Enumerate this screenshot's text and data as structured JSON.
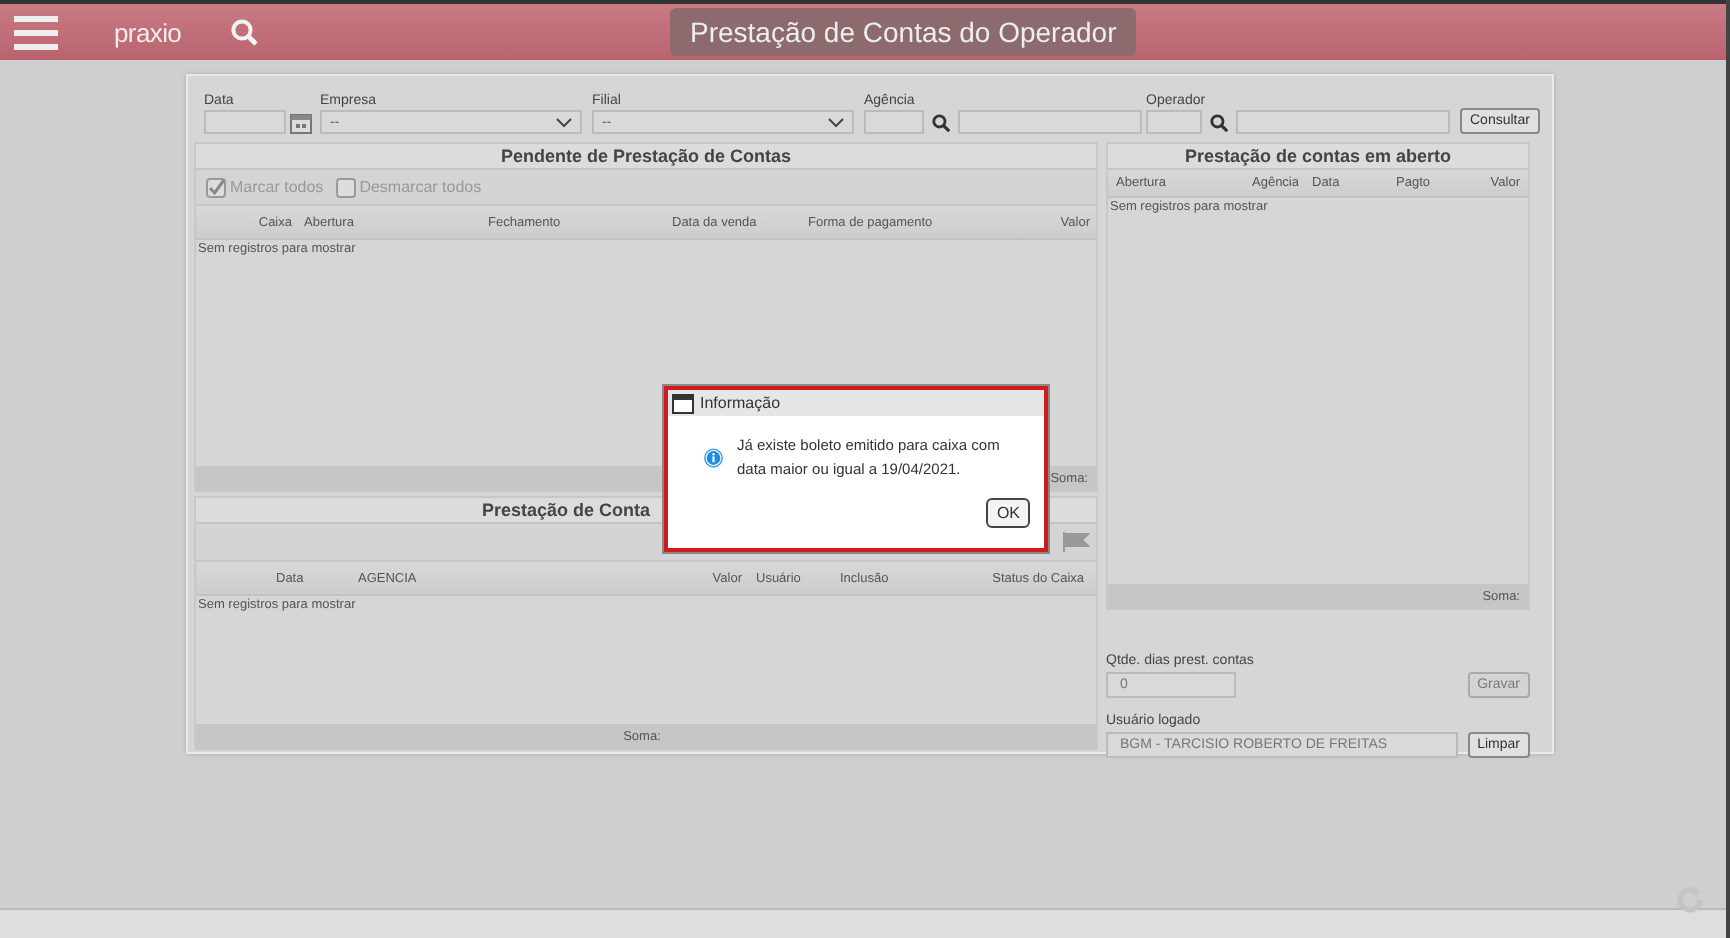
{
  "app": {
    "logo": "praxio",
    "title": "Prestação de Contas do Operador"
  },
  "filters": [
    {
      "label": "Data",
      "kind": "date"
    },
    {
      "label": "Empresa",
      "kind": "select",
      "value": "--"
    },
    {
      "label": "Filial",
      "kind": "select",
      "value": "--"
    },
    {
      "label": "Agência",
      "kind": "lookup"
    },
    {
      "label": "Operador",
      "kind": "lookup"
    }
  ],
  "consult_button": "Consultar",
  "pending": {
    "title": "Pendente de Prestação de Contas",
    "toolbar": [
      {
        "label": "Marcar todos",
        "checked": true
      },
      {
        "label": "Desmarcar todos",
        "checked": false
      }
    ],
    "columns": [
      "Caixa",
      "Abertura",
      "Fechamento",
      "Data da venda",
      "Forma de pagamento",
      "Valor"
    ],
    "empty": "Sem registros para mostrar",
    "footer": "Soma:"
  },
  "accounts": {
    "title": "Prestação de Conta",
    "columns": [
      "Data",
      "AGENCIA",
      "Valor",
      "Usuário",
      "Inclusão",
      "Status do Caixa"
    ],
    "empty": "Sem registros para mostrar",
    "footer": "Soma:"
  },
  "open": {
    "title": "Prestação de contas em aberto",
    "columns": [
      "Abertura",
      "Agência",
      "Data",
      "Pagto",
      "Valor"
    ],
    "empty": "Sem registros para mostrar",
    "footer": "Soma:"
  },
  "days": {
    "label": "Qtde. dias prest. contas",
    "value": "0",
    "button": "Gravar",
    "disabled": true
  },
  "user": {
    "label": "Usuário logado",
    "value": "BGM - TARCISIO ROBERTO DE FREITAS",
    "button": "Limpar"
  },
  "dialog": {
    "title": "Informação",
    "message": "Já existe boleto emitido para caixa com data maior ou igual a 19/04/2021.",
    "button": "OK"
  }
}
